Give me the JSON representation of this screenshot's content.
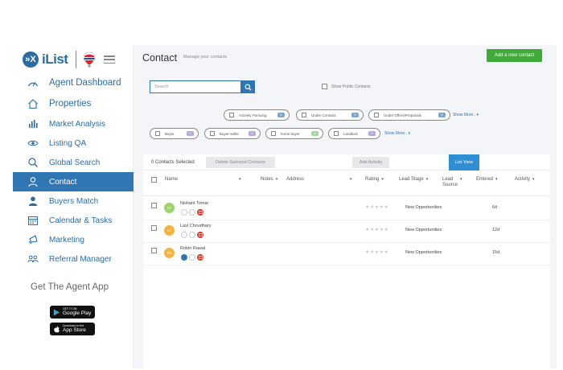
{
  "brand": {
    "name": "iList",
    "logo_mark": "»X"
  },
  "sidebar": {
    "items": [
      {
        "label": "Agent Dashboard",
        "icon": "dashboard-gauge-icon"
      },
      {
        "label": "Properties",
        "icon": "house-icon"
      },
      {
        "label": "Market Analysis",
        "icon": "bar-chart-icon"
      },
      {
        "label": "Listing QA",
        "icon": "eye-icon"
      },
      {
        "label": "Global Search",
        "icon": "search-icon"
      },
      {
        "label": "Contact",
        "icon": "person-icon",
        "active": true
      },
      {
        "label": "Buyers Match",
        "icon": "person-solid-icon"
      },
      {
        "label": "Calendar & Tasks",
        "icon": "calendar-icon"
      },
      {
        "label": "Marketing",
        "icon": "megaphone-icon"
      },
      {
        "label": "Referral Manager",
        "icon": "people-icon"
      }
    ],
    "get_app": "Get The Agent App",
    "google_play": {
      "small": "GET IT ON",
      "large": "Google Play"
    },
    "app_store": {
      "small": "Download on the",
      "large": "App Store"
    }
  },
  "header": {
    "title": "Contact",
    "subtitle": "Manage your contacts",
    "add_button": "Add a new contact"
  },
  "search": {
    "placeholder": "Search",
    "value": ""
  },
  "public_contacts": {
    "label": "Show Public Contacts",
    "checked": false
  },
  "filters": {
    "row1": [
      {
        "label": "Actively Pursuing",
        "count": "0"
      },
      {
        "label": "Under Contract",
        "count": "0"
      },
      {
        "label": "Under Offers/Proposals",
        "count": "0"
      }
    ],
    "row2": [
      {
        "label": "Buyer",
        "count": "0"
      },
      {
        "label": "Buyer-seller",
        "count": "0"
      },
      {
        "label": "home buyer",
        "count": "0"
      },
      {
        "label": "Landlord",
        "count": "0"
      }
    ],
    "show_more": "Show More.. ▾"
  },
  "toolbar": {
    "selected_count": "0 Contacts Selected",
    "delete_selected": "Delete Selected Contacts",
    "add_activity": "Add Activity",
    "list_view": "List View"
  },
  "table": {
    "columns": {
      "name": "Name",
      "notes": "Notes",
      "address": "Address",
      "rating": "Rating",
      "lead_stage": "Lead Stage",
      "lead_source": "Lead Source",
      "entered": "Entered",
      "activity": "Activity"
    },
    "rows": [
      {
        "initials": "NT",
        "name": "Nishant Tomar",
        "rating": "★★★★★",
        "lead_stage": "New Opportunities",
        "entered": "6d",
        "avatar_color": "#9dd36d"
      },
      {
        "initials": "LC",
        "name": "Lavi Choudhary",
        "rating": "★★★★★",
        "lead_stage": "New Opportunities",
        "entered": "12d",
        "avatar_color": "#f2b347"
      },
      {
        "initials": "RR",
        "name": "Robin Rawal",
        "rating": "★★★★★",
        "lead_stage": "New Opportunities",
        "entered": "15d",
        "avatar_color": "#f2b347"
      }
    ]
  },
  "colors": {
    "primary": "#2f76b3",
    "add_button": "#3faa3a",
    "list_view": "#2f8fd4"
  }
}
